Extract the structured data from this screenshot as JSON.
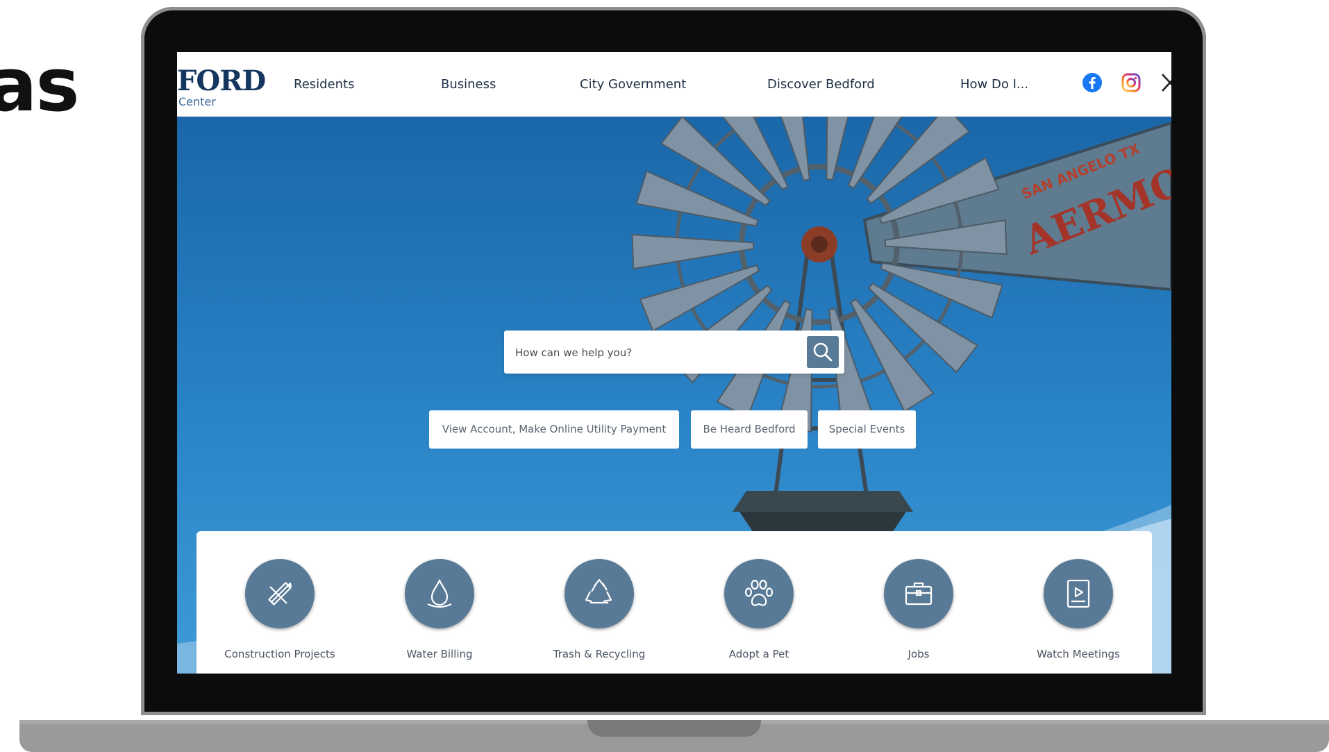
{
  "side_heading": "as",
  "logo": {
    "main": "FORD",
    "sub": "Center"
  },
  "nav": [
    {
      "label": "Residents"
    },
    {
      "label": "Business"
    },
    {
      "label": "City Government"
    },
    {
      "label": "Discover Bedford"
    },
    {
      "label": "How Do I..."
    }
  ],
  "social": [
    {
      "icon": "facebook-icon",
      "color": "#1877f2"
    },
    {
      "icon": "instagram-icon",
      "color": "#d62976"
    },
    {
      "icon": "x-icon",
      "color": "#222222"
    }
  ],
  "search": {
    "placeholder": "How can we help you?"
  },
  "quick_links": [
    {
      "label": "View Account, Make Online Utility Payment"
    },
    {
      "label": "Be Heard Bedford"
    },
    {
      "label": "Special Events"
    }
  ],
  "sign_text": {
    "top": "SAN ANGELO TX",
    "main": "AERMOT"
  },
  "services": [
    {
      "label": "Construction Projects",
      "icon": "pencil-ruler-icon"
    },
    {
      "label": "Water Billing",
      "icon": "water-drop-icon"
    },
    {
      "label": "Trash & Recycling",
      "icon": "recycle-icon"
    },
    {
      "label": "Adopt a Pet",
      "icon": "paw-icon"
    },
    {
      "label": "Jobs",
      "icon": "briefcase-icon"
    },
    {
      "label": "Watch Meetings",
      "icon": "video-play-icon"
    }
  ],
  "colors": {
    "accent": "#587a96",
    "sky": "#2a84c7",
    "navy": "#15365e"
  }
}
